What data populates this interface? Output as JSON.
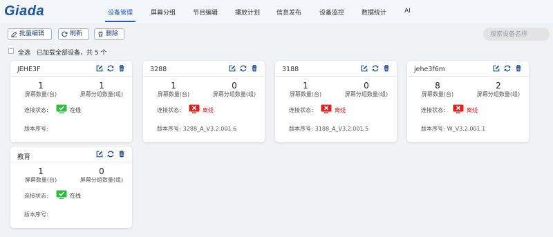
{
  "app": {
    "logo": "Giada",
    "colors": {
      "primary": "#1f5fbf",
      "online": "#2ebd3d",
      "offline": "#e02020"
    }
  },
  "nav": [
    {
      "label": "设备管理",
      "active": true
    },
    {
      "label": "屏幕分组",
      "active": false
    },
    {
      "label": "节目编辑",
      "active": false
    },
    {
      "label": "播放计划",
      "active": false
    },
    {
      "label": "信息发布",
      "active": false
    },
    {
      "label": "设备监控",
      "active": false
    },
    {
      "label": "数据统计",
      "active": false
    },
    {
      "label": "AI",
      "active": false
    }
  ],
  "toolbar": {
    "batch_edit": "批量编辑",
    "refresh": "刷新",
    "delete": "删除",
    "search_placeholder": "搜索设备名称",
    "select_all": "全选",
    "loaded_text": "已加载全部设备，共 5 个"
  },
  "card_labels": {
    "screen_count": "屏幕数量(台)",
    "group_count": "屏幕分组数量(组)",
    "conn_status": "连接状态:",
    "version": "版本序号:"
  },
  "devices": [
    {
      "name": "JEHE3F",
      "screens": "1",
      "groups": "1",
      "status": "在线",
      "online": true,
      "version": ""
    },
    {
      "name": "3288",
      "screens": "1",
      "groups": "0",
      "status": "离线",
      "online": false,
      "version": "3288_A_V3.2.001.6"
    },
    {
      "name": "3188",
      "screens": "1",
      "groups": "0",
      "status": "离线",
      "online": false,
      "version": "3188_A_V3.2.001.5"
    },
    {
      "name": "jehe3f6m",
      "screens": "8",
      "groups": "2",
      "status": "离线",
      "online": false,
      "version": "W_V3.2.001.1"
    },
    {
      "name": "教育",
      "screens": "1",
      "groups": "0",
      "status": "在线",
      "online": true,
      "version": ""
    }
  ]
}
